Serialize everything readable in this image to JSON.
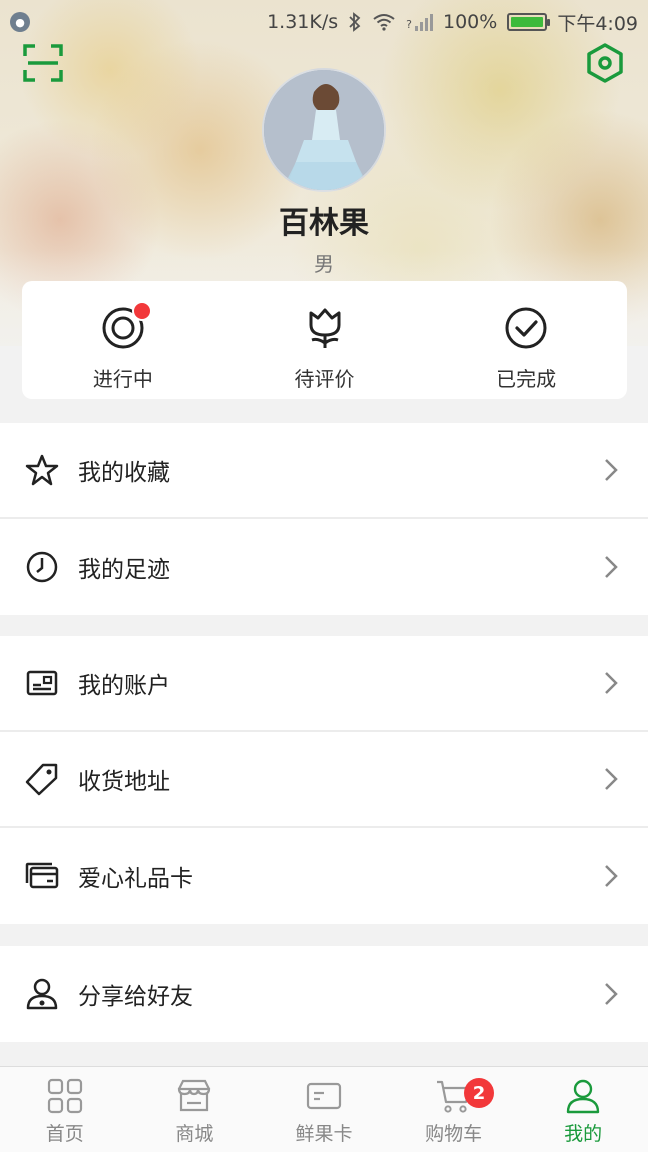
{
  "status_bar": {
    "speed": "1.31K/s",
    "bluetooth": "bluetooth-icon",
    "wifi": "wifi-icon",
    "signal": "?",
    "battery_percent": "100%",
    "time": "下午4:09"
  },
  "profile": {
    "name": "百林果",
    "gender": "男"
  },
  "orders": [
    {
      "label": "进行中",
      "icon": "order-in-progress-icon",
      "has_dot": true
    },
    {
      "label": "待评价",
      "icon": "tulip-icon",
      "has_dot": false
    },
    {
      "label": "已完成",
      "icon": "check-circle-icon",
      "has_dot": false
    }
  ],
  "menu": {
    "group1": [
      {
        "label": "我的收藏",
        "icon": "star-icon"
      },
      {
        "label": "我的足迹",
        "icon": "clock-icon"
      }
    ],
    "group2": [
      {
        "label": "我的账户",
        "icon": "account-card-icon"
      },
      {
        "label": "收货地址",
        "icon": "tag-icon"
      },
      {
        "label": "爱心礼品卡",
        "icon": "gift-card-icon"
      }
    ],
    "group3": [
      {
        "label": "分享给好友",
        "icon": "share-person-icon"
      }
    ]
  },
  "bottom_nav": [
    {
      "label": "首页",
      "icon": "grid-icon"
    },
    {
      "label": "商城",
      "icon": "shop-icon"
    },
    {
      "label": "鲜果卡",
      "icon": "card-icon"
    },
    {
      "label": "购物车",
      "icon": "cart-icon",
      "badge": "2"
    },
    {
      "label": "我的",
      "icon": "user-icon",
      "active": true
    }
  ],
  "colors": {
    "accent_green": "#1a9a3c",
    "badge_red": "#f2383a"
  }
}
